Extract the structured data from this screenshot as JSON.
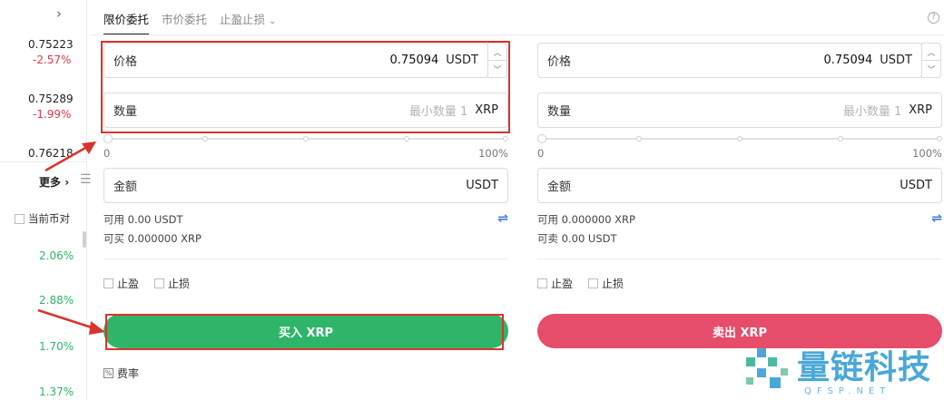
{
  "left_list": {
    "rows": [
      {
        "price": "0.75223",
        "change": "-2.57%"
      },
      {
        "price": "0.75289",
        "change": "-1.99%"
      },
      {
        "price": "0.76218"
      }
    ],
    "more_label": "更多",
    "current_pair_label": "当前币对",
    "percents": [
      "2.06%",
      "2.88%",
      "1.70%",
      "1.37%"
    ]
  },
  "tabs": [
    {
      "label": "限价委托",
      "active": true
    },
    {
      "label": "市价委托",
      "active": false
    },
    {
      "label": "止盈止损",
      "active": false
    }
  ],
  "buy": {
    "price_label": "价格",
    "price_value": "0.75094",
    "price_unit": "USDT",
    "qty_label": "数量",
    "qty_placeholder": "最小数量 1",
    "qty_unit": "XRP",
    "slider_min": "0",
    "slider_max": "100%",
    "amount_label": "金额",
    "amount_unit": "USDT",
    "available": "可用 0.00 USDT",
    "can_trade": "可买 0.000000 XRP",
    "tp_label": "止盈",
    "sl_label": "止损",
    "button_label": "买入 XRP",
    "fee_label": "费率"
  },
  "sell": {
    "price_label": "价格",
    "price_value": "0.75094",
    "price_unit": "USDT",
    "qty_label": "数量",
    "qty_placeholder": "最小数量 1",
    "qty_unit": "XRP",
    "slider_min": "0",
    "slider_max": "100%",
    "amount_label": "金额",
    "amount_unit": "USDT",
    "available": "可用 0.000000 XRP",
    "can_trade": "可卖 0.00 USDT",
    "tp_label": "止盈",
    "sl_label": "止损",
    "button_label": "卖出 XRP"
  },
  "colors": {
    "buy": "#2fb56a",
    "sell": "#e54d6b",
    "down": "#e0384f",
    "up": "#2fb56a",
    "annotation": "#d9342b"
  },
  "icons": [
    "chevron-right-icon",
    "menu-icon",
    "help-icon",
    "swap-icon",
    "fee-icon",
    "stepper-up-icon",
    "stepper-down-icon"
  ],
  "watermark": {
    "brand": "量链科技",
    "sub": "QFSP.NET"
  }
}
